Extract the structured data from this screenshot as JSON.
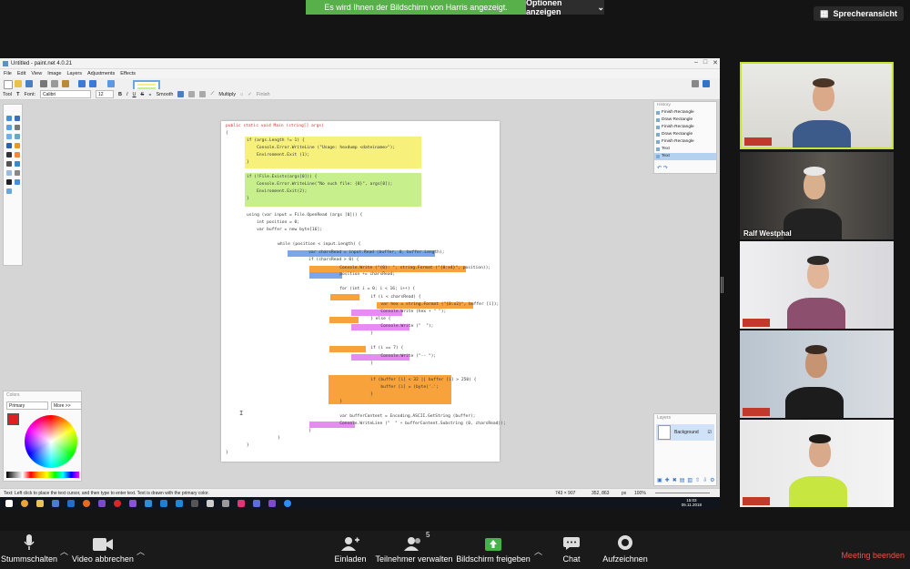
{
  "banner": {
    "message": "Es wird Ihnen der Bildschirm von Harris angezeigt.",
    "options_label": "Optionen anzeigen",
    "speaker_view": "Sprecheransicht"
  },
  "paintnet": {
    "title": "Untitled - paint.net 4.0.21",
    "menu": [
      "File",
      "Edit",
      "View",
      "Image",
      "Layers",
      "Adjustments",
      "Effects"
    ],
    "toolbar": {
      "tool_label": "Tool",
      "font_label": "Font:",
      "font_value": "Calibri",
      "size_value": "12",
      "bold": "B",
      "italic": "I",
      "underline": "U",
      "strike": "S",
      "smoothing": "Smooth",
      "blend_mode": "Multiply",
      "finish": "Finish"
    },
    "history": {
      "title": "History",
      "items": [
        {
          "label": "Finish Rectangle",
          "selected": false
        },
        {
          "label": "Draw Rectangle",
          "selected": false
        },
        {
          "label": "Finish Rectangle",
          "selected": false
        },
        {
          "label": "Draw Rectangle",
          "selected": false
        },
        {
          "label": "Finish Rectangle",
          "selected": false
        },
        {
          "label": "Text",
          "selected": false
        },
        {
          "label": "Text",
          "selected": true
        }
      ]
    },
    "layers": {
      "title": "Layers",
      "items": [
        "Background"
      ]
    },
    "colors": {
      "title": "Colors",
      "mode": "Primary",
      "more": "More >>"
    },
    "status_text": "Text: Left click to place the text cursor, and then type to enter text. Text is drawn with the primary color.",
    "canvas_size": "743 × 907",
    "cursor_pos": "352, 863",
    "unit": "px",
    "zoom": "100%",
    "code_lines": [
      "public static void Main (string[] args)",
      "{",
      "if (args.Length != 1) {",
      "    Console.Error.WriteLine (\"Usage: hexdump <dateiname>\");",
      "    Environment.Exit (1);",
      "}",
      "if (!File.Exists(args[0])) {",
      "    Console.Error.WriteLine(\"No such file: {0}\", args[0]);",
      "    Environment.Exit(2);",
      "}",
      "using (var input = File.OpenRead (args [0])) {",
      "    int position = 0;",
      "    var buffer = new byte[16];",
      "    while (position < input.Length) {",
      "        var charsRead = input.Read (buffer, 0, buffer.Length);",
      "        if (charsRead > 0) {",
      "            Console.Write (\"{0}: \", string.Format (\"{0:x4}\", position));",
      "            position += charsRead;",
      "            for (int i = 0; i < 16; i++) {",
      "                if (i < charsRead) {",
      "                    var hex = string.Format (\"{0:x2}\", buffer [i]);",
      "                    Console.Write (hex + \" \");",
      "                } else {",
      "                    Console.Write (\"  \");",
      "                }",
      "                if (i == 7) {",
      "                    Console.Write (\"-- \");",
      "                }",
      "                if (buffer [i] < 32 || buffer [i] > 250) {",
      "                    buffer [i] = (byte)'.';",
      "                }",
      "            }",
      "            var bufferContent = Encoding.ASCII.GetString (buffer);",
      "            Console.WriteLine (\"  \" + bufferContent.Substring (0, charsRead));",
      "        }",
      "    }",
      "}",
      "}"
    ],
    "clock_time": "15:03",
    "clock_date": "05.11.2018"
  },
  "participants": [
    {
      "name": "",
      "active": true
    },
    {
      "name": "Ralf Westphal",
      "active": false
    },
    {
      "name": "",
      "active": false
    },
    {
      "name": "",
      "active": false
    },
    {
      "name": "",
      "active": false
    }
  ],
  "controls": {
    "mute": "Stummschalten",
    "video": "Video abbrechen",
    "invite": "Einladen",
    "participants": "Teilnehmer verwalten",
    "participants_count": "5",
    "share": "Bildschirm freigeben",
    "chat": "Chat",
    "record": "Aufzeichnen",
    "end": "Meeting beenden"
  },
  "colors": {
    "banner_green": "#58b04b",
    "active_speaker": "#c7e33a",
    "end_red": "#e8534a",
    "hl_yellow": "#f7f07a",
    "hl_green": "#c7f08d",
    "hl_blue": "#7aa7ea",
    "hl_orange": "#f7a23a",
    "hl_magenta": "#e58bf2"
  }
}
